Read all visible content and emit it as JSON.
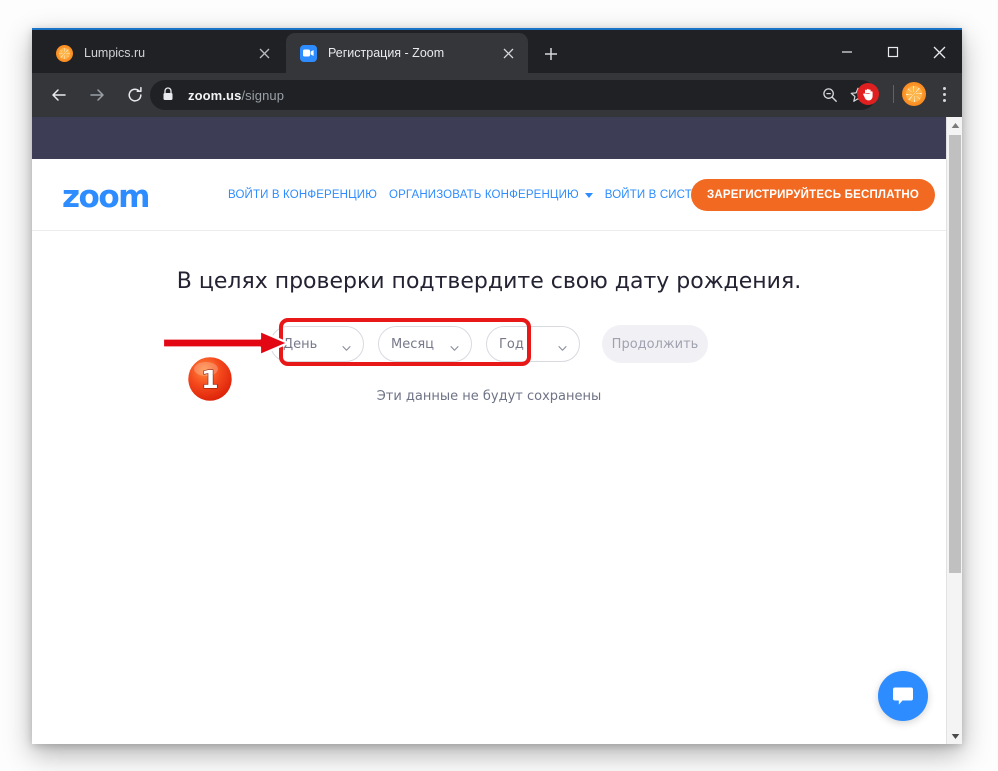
{
  "browser": {
    "tabs": [
      {
        "title": "Lumpics.ru",
        "favicon": "orange-slice-icon",
        "active": false
      },
      {
        "title": "Регистрация - Zoom",
        "favicon": "zoom-camera-icon",
        "active": true
      }
    ],
    "new_tab_label": "+",
    "window_controls": {
      "minimize": "minimize-icon",
      "maximize": "maximize-icon",
      "close": "close-icon"
    },
    "toolbar": {
      "back": "back-arrow-icon",
      "forward": "forward-arrow-icon",
      "reload": "reload-icon",
      "lock": "lock-icon",
      "url_domain": "zoom.us",
      "url_path": "/signup",
      "zoom_out_icon": "magnifier-minus-icon",
      "bookmark_icon": "star-icon",
      "extension_icon": "hand-block-extension-icon",
      "profile_icon": "orange-avatar-icon",
      "menu_icon": "three-dots-menu-icon"
    },
    "scrollbar": {
      "up_arrow": "scroll-up-arrow-icon",
      "down_arrow": "scroll-down-arrow-icon"
    }
  },
  "site": {
    "logo_text": "zoom",
    "nav_links": [
      {
        "label": "ВОЙТИ В КОНФЕРЕНЦИЮ",
        "has_caret": false
      },
      {
        "label": "ОРГАНИЗОВАТЬ КОНФЕРЕНЦИЮ",
        "has_caret": true
      },
      {
        "label": "ВОЙТИ В СИСТЕМУ",
        "has_caret": false
      }
    ],
    "signup_button": "ЗАРЕГИСТРИРУЙТЕСЬ БЕСПЛАТНО",
    "main": {
      "heading": "В целях проверки подтвердите свою дату рождения.",
      "selects": [
        {
          "label": "День",
          "name": "day-select"
        },
        {
          "label": "Месяц",
          "name": "month-select"
        },
        {
          "label": "Год",
          "name": "year-select"
        }
      ],
      "continue_button": "Продолжить",
      "note": "Эти данные не будут сохранены"
    },
    "chat_button": "chat-bubble-icon"
  },
  "annotations": {
    "step_number": "1",
    "accent_color": "#e81818",
    "badge_color": "#f0421a",
    "arrow_icon": "red-arrow-right-icon",
    "highlight_icon": "red-rounded-rect-highlight"
  }
}
